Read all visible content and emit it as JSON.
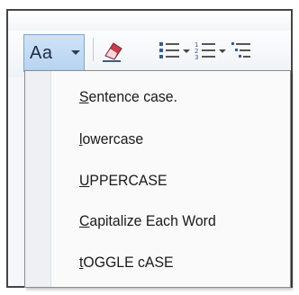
{
  "toolbar": {
    "change_case_label": "Aa",
    "icons": [
      "change-case-icon",
      "eraser-icon",
      "bullets-icon",
      "numbering-icon",
      "multilevel-list-icon"
    ]
  },
  "menu": {
    "items": [
      {
        "accel": "S",
        "rest": "entence case."
      },
      {
        "accel": "l",
        "rest": "owercase"
      },
      {
        "accel": "U",
        "rest": "PPERCASE"
      },
      {
        "accel": "C",
        "rest": "apitalize Each Word"
      },
      {
        "accel": "t",
        "rest": "OGGLE cASE"
      }
    ]
  },
  "colors": {
    "pressed_button": "#b6d3f0",
    "menu_background": "#fafafa",
    "menu_border": "#8c8c8c"
  }
}
